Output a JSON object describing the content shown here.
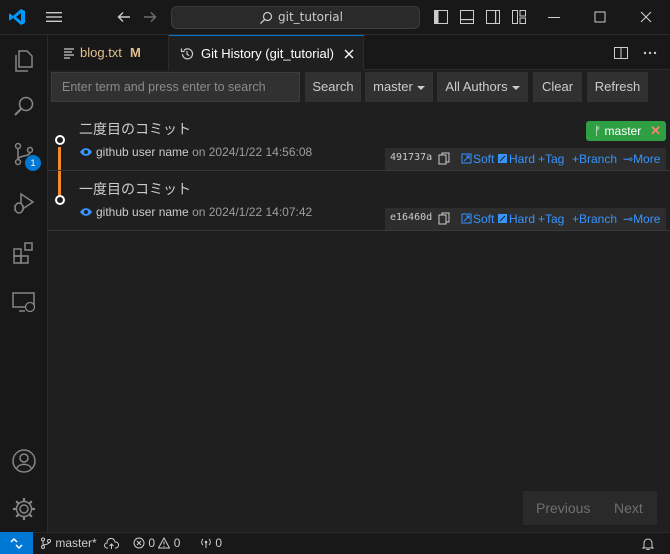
{
  "titlebar": {
    "search_text": "git_tutorial",
    "icons": [
      "vscode-logo-icon",
      "menu-icon",
      "arrow-left-icon",
      "arrow-right-icon",
      "search-icon",
      "toggle-primary-sidebar-icon",
      "toggle-panel-icon",
      "toggle-secondary-sidebar-icon",
      "customize-layout-icon",
      "minimize-icon",
      "maximize-icon",
      "close-icon"
    ]
  },
  "activitybar": {
    "items": [
      "explorer-icon",
      "search-icon",
      "source-control-icon",
      "run-debug-icon",
      "extensions-icon",
      "remote-explorer-icon"
    ],
    "scm_badge": "1",
    "bottom": [
      "accounts-icon",
      "manage-gear-icon"
    ]
  },
  "tabs": [
    {
      "label": "blog.txt",
      "modified": "M"
    },
    {
      "label": "Git History (git_tutorial)"
    }
  ],
  "toolbar": {
    "search_placeholder": "Enter term and press enter to search",
    "search_label": "Search",
    "branch_label": "master",
    "authors_label": "All Authors",
    "clear_label": "Clear",
    "refresh_label": "Refresh"
  },
  "commits": [
    {
      "title": "二度目のコミット",
      "author": "github user name",
      "date": "on 2024/1/22 14:56:08",
      "hash": "491737a",
      "branch": "master",
      "actions": {
        "soft": "Soft",
        "hard": "Hard",
        "tag": "+Tag",
        "branch": "+Branch",
        "more": "More"
      }
    },
    {
      "title": "一度目のコミット",
      "author": "github user name",
      "date": "on 2024/1/22 14:07:42",
      "hash": "e16460d",
      "actions": {
        "soft": "Soft",
        "hard": "Hard",
        "tag": "+Tag",
        "branch": "+Branch",
        "more": "More"
      }
    }
  ],
  "pager": {
    "previous": "Previous",
    "next": "Next"
  },
  "statusbar": {
    "branch": "master*",
    "errors": "0",
    "warnings": "0",
    "ports": "0"
  },
  "colors": {
    "accent": "#0078d4",
    "graph_line": "#f28c28",
    "branch_badge": "#2ea043",
    "link": "#3794ff"
  }
}
